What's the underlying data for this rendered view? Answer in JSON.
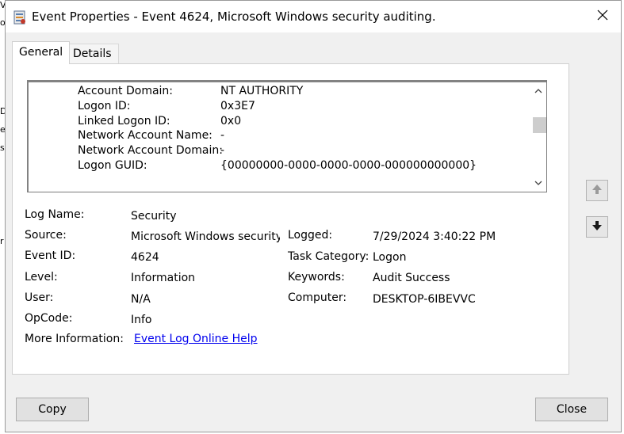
{
  "window": {
    "title": "Event Properties - Event 4624, Microsoft Windows security auditing."
  },
  "tabs": [
    {
      "label": "General"
    },
    {
      "label": "Details"
    }
  ],
  "description_rows": [
    {
      "label": "Account Domain:",
      "value": "NT AUTHORITY"
    },
    {
      "label": "Logon ID:",
      "value": "0x3E7"
    },
    {
      "label": "Linked Logon ID:",
      "value": "0x0"
    },
    {
      "label": "Network Account Name:",
      "value": "-"
    },
    {
      "label": "Network Account Domain:",
      "value": "-"
    },
    {
      "label": "Logon GUID:",
      "value": "{00000000-0000-0000-0000-000000000000}"
    }
  ],
  "fields": {
    "log_name": {
      "label": "Log Name:",
      "value": "Security"
    },
    "source": {
      "label": "Source:",
      "value": "Microsoft Windows security a"
    },
    "event_id": {
      "label": "Event ID:",
      "value": "4624"
    },
    "level": {
      "label": "Level:",
      "value": "Information"
    },
    "user": {
      "label": "User:",
      "value": "N/A"
    },
    "opcode": {
      "label": "OpCode:",
      "value": "Info"
    },
    "more_info": {
      "label": "More Information:",
      "value": "Event Log Online Help"
    },
    "logged": {
      "label": "Logged:",
      "value": "7/29/2024 3:40:22 PM"
    },
    "task_category": {
      "label": "Task Category:",
      "value": "Logon"
    },
    "keywords": {
      "label": "Keywords:",
      "value": "Audit Success"
    },
    "computer": {
      "label": "Computer:",
      "value": "DESKTOP-6IBEVVC"
    }
  },
  "buttons": {
    "copy": "Copy",
    "close": "Close"
  },
  "background_edge_glyphs": [
    "V",
    "o",
    "D",
    "e",
    "s",
    "r"
  ]
}
